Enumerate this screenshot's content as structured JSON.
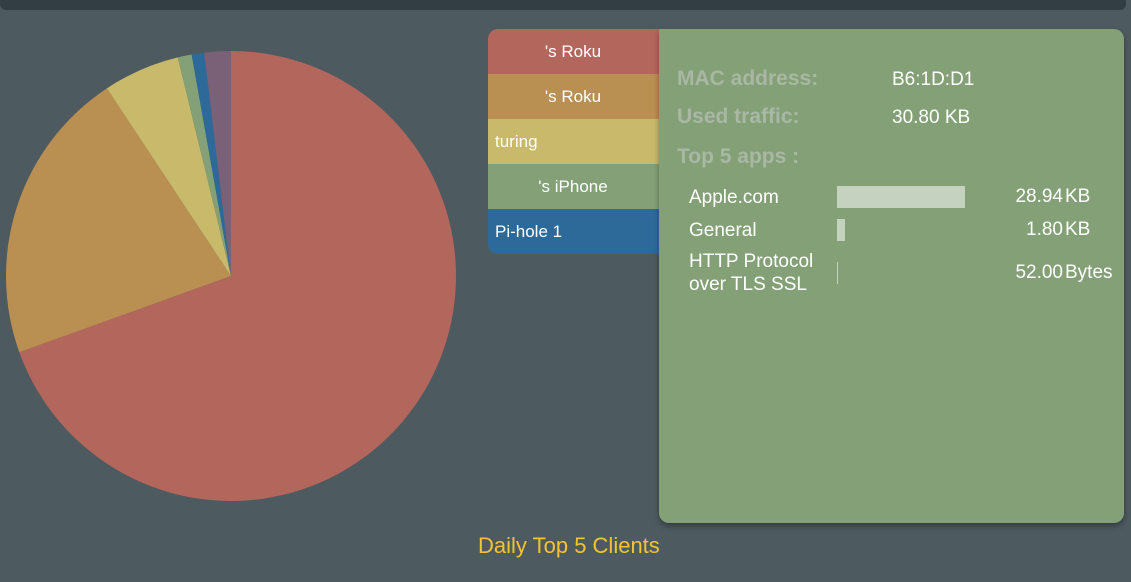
{
  "clients": [
    {
      "label": "'s Roku",
      "color": "#b3665c",
      "align": "center"
    },
    {
      "label": "'s Roku",
      "color": "#b98f52",
      "align": "center"
    },
    {
      "label": "turing",
      "color": "#c9b96b",
      "align": "left"
    },
    {
      "label": "'s iPhone",
      "color": "#83a076",
      "align": "center"
    },
    {
      "label": "Pi-hole 1",
      "color": "#2e6a99",
      "align": "left"
    }
  ],
  "details": {
    "mac_label": "MAC address:",
    "mac_value": "B6:1D:D1",
    "traffic_label": "Used traffic:",
    "traffic_value": "30.80 KB",
    "top_apps_label": "Top 5 apps :",
    "apps": [
      {
        "name": "Apple.com",
        "value": "28.94",
        "unit": "KB",
        "share": 0.94
      },
      {
        "name": "General",
        "value": "1.80",
        "unit": "KB",
        "share": 0.06
      },
      {
        "name": "HTTP Protocol over TLS SSL",
        "value": "52.00",
        "unit": "Bytes",
        "share": 0.002
      }
    ]
  },
  "chart_data": {
    "type": "pie",
    "title": "Daily Top 5 Clients",
    "slices": [
      {
        "name": "'s Roku",
        "value": 69.5,
        "color": "#b3665c"
      },
      {
        "name": "'s Roku",
        "value": 21.2,
        "color": "#b98f52"
      },
      {
        "name": "turing",
        "value": 5.5,
        "color": "#c9b96b"
      },
      {
        "name": "'s iPhone",
        "value": 1.0,
        "color": "#83a076"
      },
      {
        "name": "Pi-hole 1",
        "value": 0.9,
        "color": "#2e6a99"
      },
      {
        "name": "",
        "value": 1.9,
        "color": "#7b6178"
      }
    ]
  }
}
